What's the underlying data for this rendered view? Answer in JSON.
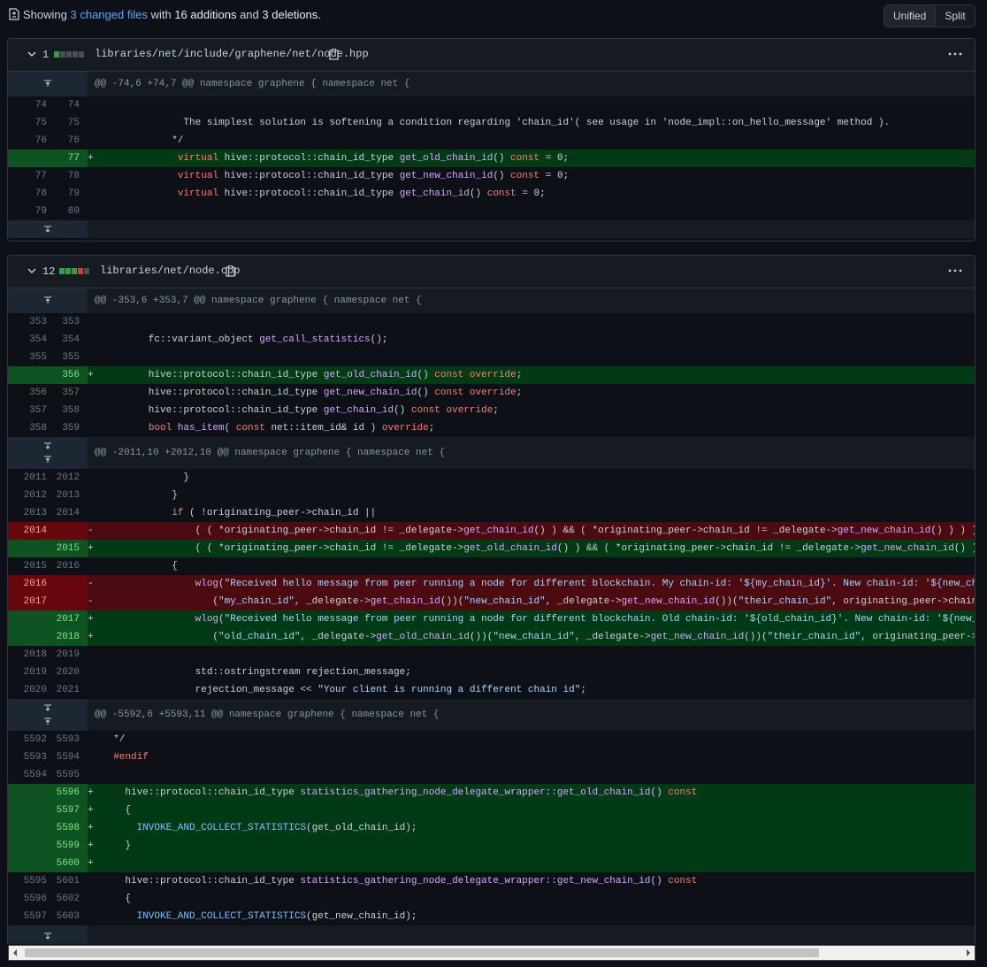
{
  "summary": {
    "prefix": "Showing",
    "files_link": "3 changed files",
    "with": "with",
    "additions": "16 additions",
    "and": "and",
    "deletions": "3 deletions."
  },
  "view_toggle": {
    "unified": "Unified",
    "split": "Split"
  },
  "files": [
    {
      "changes": "1",
      "path": "libraries/net/include/graphene/net/node.hpp",
      "hunks": [
        {
          "header": "@@ -74,6 +74,7 @@ namespace graphene { namespace net {"
        }
      ]
    },
    {
      "changes": "12",
      "path": "libraries/net/node.cpp",
      "hunks": [
        {
          "header": "@@ -353,6 +353,7 @@ namespace graphene { namespace net {"
        },
        {
          "header": "@@ -2011,10 +2012,10 @@ namespace graphene { namespace net {"
        },
        {
          "header": "@@ -5592,6 +5593,11 @@ namespace graphene { namespace net {"
        }
      ]
    }
  ],
  "lines": {
    "f1": [
      {
        "o": "74",
        "n": "74",
        "t": "ctx",
        "c": ""
      },
      {
        "o": "75",
        "n": "75",
        "t": "ctx",
        "c": "              The simplest solution is softening a condition regarding 'chain_id'( see usage in 'node_impl::on_hello_message' method )."
      },
      {
        "o": "76",
        "n": "76",
        "t": "ctx",
        "c": "            */"
      },
      {
        "o": "",
        "n": "77",
        "t": "add",
        "c": "             virtual hive::protocol::chain_id_type get_old_chain_id() const = 0;"
      },
      {
        "o": "77",
        "n": "78",
        "t": "ctx",
        "c": "             virtual hive::protocol::chain_id_type get_new_chain_id() const = 0;"
      },
      {
        "o": "78",
        "n": "79",
        "t": "ctx",
        "c": "             virtual hive::protocol::chain_id_type get_chain_id() const = 0;"
      },
      {
        "o": "79",
        "n": "80",
        "t": "ctx",
        "c": ""
      }
    ],
    "f2a": [
      {
        "o": "353",
        "n": "353",
        "t": "ctx",
        "c": ""
      },
      {
        "o": "354",
        "n": "354",
        "t": "ctx",
        "c": "        fc::variant_object get_call_statistics();"
      },
      {
        "o": "355",
        "n": "355",
        "t": "ctx",
        "c": ""
      },
      {
        "o": "",
        "n": "356",
        "t": "add",
        "c": "        hive::protocol::chain_id_type get_old_chain_id() const override;"
      },
      {
        "o": "356",
        "n": "357",
        "t": "ctx",
        "c": "        hive::protocol::chain_id_type get_new_chain_id() const override;"
      },
      {
        "o": "357",
        "n": "358",
        "t": "ctx",
        "c": "        hive::protocol::chain_id_type get_chain_id() const override;"
      },
      {
        "o": "358",
        "n": "359",
        "t": "ctx",
        "c": "        bool has_item( const net::item_id& id ) override;"
      }
    ],
    "f2b": [
      {
        "o": "2011",
        "n": "2012",
        "t": "ctx",
        "c": "              }"
      },
      {
        "o": "2012",
        "n": "2013",
        "t": "ctx",
        "c": "            }"
      },
      {
        "o": "2013",
        "n": "2014",
        "t": "ctx",
        "c": "            if ( !originating_peer->chain_id ||"
      },
      {
        "o": "2014",
        "n": "",
        "t": "del",
        "c": "                ( ( *originating_peer->chain_id != _delegate->get_chain_id() ) && ( *originating_peer->chain_id != _delegate->get_new_chain_id() ) ) )"
      },
      {
        "o": "",
        "n": "2015",
        "t": "add",
        "c": "                ( ( *originating_peer->chain_id != _delegate->get_old_chain_id() ) && ( *originating_peer->chain_id != _delegate->get_new_chain_id() ) ) )"
      },
      {
        "o": "2015",
        "n": "2016",
        "t": "ctx",
        "c": "            {"
      },
      {
        "o": "2016",
        "n": "",
        "t": "del",
        "c": "                wlog(\"Received hello message from peer running a node for different blockchain. My chain-id: '${my_chain_id}'. New chain-id: '${new_chain_id}'. Their chain-id: '${their_chain_id}'\","
      },
      {
        "o": "2017",
        "n": "",
        "t": "del",
        "c": "                   (\"my_chain_id\", _delegate->get_chain_id())(\"new_chain_id\", _delegate->get_new_chain_id())(\"their_chain_id\", originating_peer->chain_id) );"
      },
      {
        "o": "",
        "n": "2017",
        "t": "add",
        "c": "                wlog(\"Received hello message from peer running a node for different blockchain. Old chain-id: '${old_chain_id}'. New chain-id: '${new_chain_id}'. Their chain-id: '${their_chain_id}'\","
      },
      {
        "o": "",
        "n": "2018",
        "t": "add",
        "c": "                   (\"old_chain_id\", _delegate->get_old_chain_id())(\"new_chain_id\", _delegate->get_new_chain_id())(\"their_chain_id\", originating_peer->chain_id) );"
      },
      {
        "o": "2018",
        "n": "2019",
        "t": "ctx",
        "c": ""
      },
      {
        "o": "2019",
        "n": "2020",
        "t": "ctx",
        "c": "                std::ostringstream rejection_message;"
      },
      {
        "o": "2020",
        "n": "2021",
        "t": "ctx",
        "c": "                rejection_message << \"Your client is running a different chain id\";"
      }
    ],
    "f2c": [
      {
        "o": "5592",
        "n": "5593",
        "t": "ctx",
        "c": "  */"
      },
      {
        "o": "5593",
        "n": "5594",
        "t": "ctx",
        "c": "  #endif"
      },
      {
        "o": "5594",
        "n": "5595",
        "t": "ctx",
        "c": ""
      },
      {
        "o": "",
        "n": "5596",
        "t": "add",
        "c": "    hive::protocol::chain_id_type statistics_gathering_node_delegate_wrapper::get_old_chain_id() const"
      },
      {
        "o": "",
        "n": "5597",
        "t": "add",
        "c": "    {"
      },
      {
        "o": "",
        "n": "5598",
        "t": "add",
        "c": "      INVOKE_AND_COLLECT_STATISTICS(get_old_chain_id);"
      },
      {
        "o": "",
        "n": "5599",
        "t": "add",
        "c": "    }"
      },
      {
        "o": "",
        "n": "5600",
        "t": "add",
        "c": ""
      },
      {
        "o": "5595",
        "n": "5601",
        "t": "ctx",
        "c": "    hive::protocol::chain_id_type statistics_gathering_node_delegate_wrapper::get_new_chain_id() const"
      },
      {
        "o": "5596",
        "n": "5602",
        "t": "ctx",
        "c": "    {"
      },
      {
        "o": "5597",
        "n": "5603",
        "t": "ctx",
        "c": "      INVOKE_AND_COLLECT_STATISTICS(get_new_chain_id);"
      }
    ]
  },
  "colors": {
    "added": "#033a16",
    "deleted": "#4c0a11",
    "link": "#58a6ff"
  }
}
